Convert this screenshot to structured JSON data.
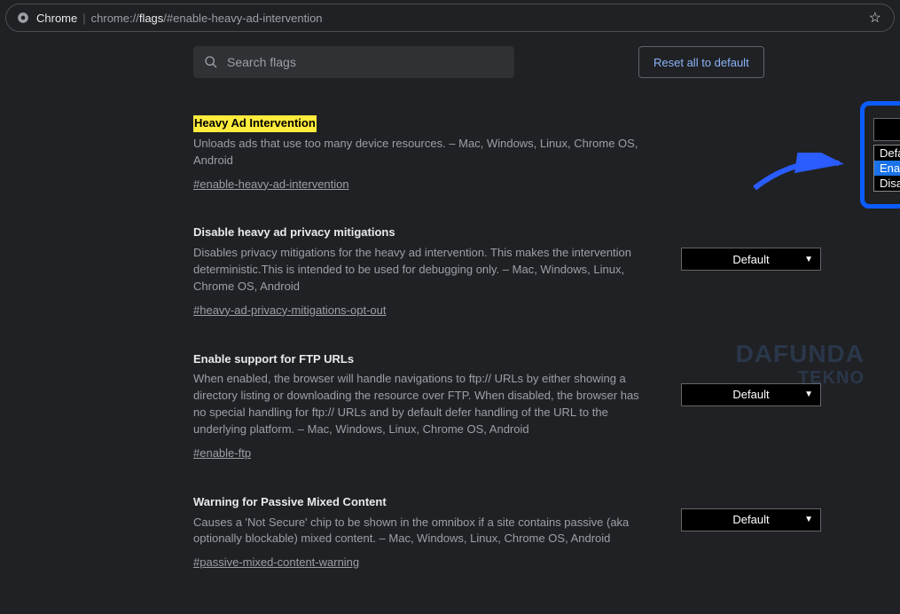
{
  "address": {
    "chrome_label": "Chrome",
    "url_pre": "chrome://",
    "url_bold": "flags",
    "url_post": "/#enable-heavy-ad-intervention"
  },
  "search": {
    "placeholder": "Search flags"
  },
  "reset_label": "Reset all to default",
  "dropdown": {
    "default_label": "Default",
    "options": {
      "o0": "Default",
      "o1": "Enabled",
      "o2": "Disabled"
    }
  },
  "flags": {
    "f0": {
      "title": "Heavy Ad Intervention",
      "desc": "Unloads ads that use too many device resources. – Mac, Windows, Linux, Chrome OS, Android",
      "anchor": "#enable-heavy-ad-intervention"
    },
    "f1": {
      "title": "Disable heavy ad privacy mitigations",
      "desc": "Disables privacy mitigations for the heavy ad intervention. This makes the intervention deterministic.This is intended to be used for debugging only. – Mac, Windows, Linux, Chrome OS, Android",
      "anchor": "#heavy-ad-privacy-mitigations-opt-out"
    },
    "f2": {
      "title": "Enable support for FTP URLs",
      "desc": "When enabled, the browser will handle navigations to ftp:// URLs by either showing a directory listing or downloading the resource over FTP. When disabled, the browser has no special handling for ftp:// URLs and by default defer handling of the URL to the underlying platform. – Mac, Windows, Linux, Chrome OS, Android",
      "anchor": "#enable-ftp"
    },
    "f3": {
      "title": "Warning for Passive Mixed Content",
      "desc": "Causes a 'Not Secure' chip to be shown in the omnibox if a site contains passive (aka optionally blockable) mixed content. – Mac, Windows, Linux, Chrome OS, Android",
      "anchor": "#passive-mixed-content-warning"
    }
  },
  "watermark": {
    "line1": "DAFUNDA",
    "line2": "TEKNO"
  }
}
